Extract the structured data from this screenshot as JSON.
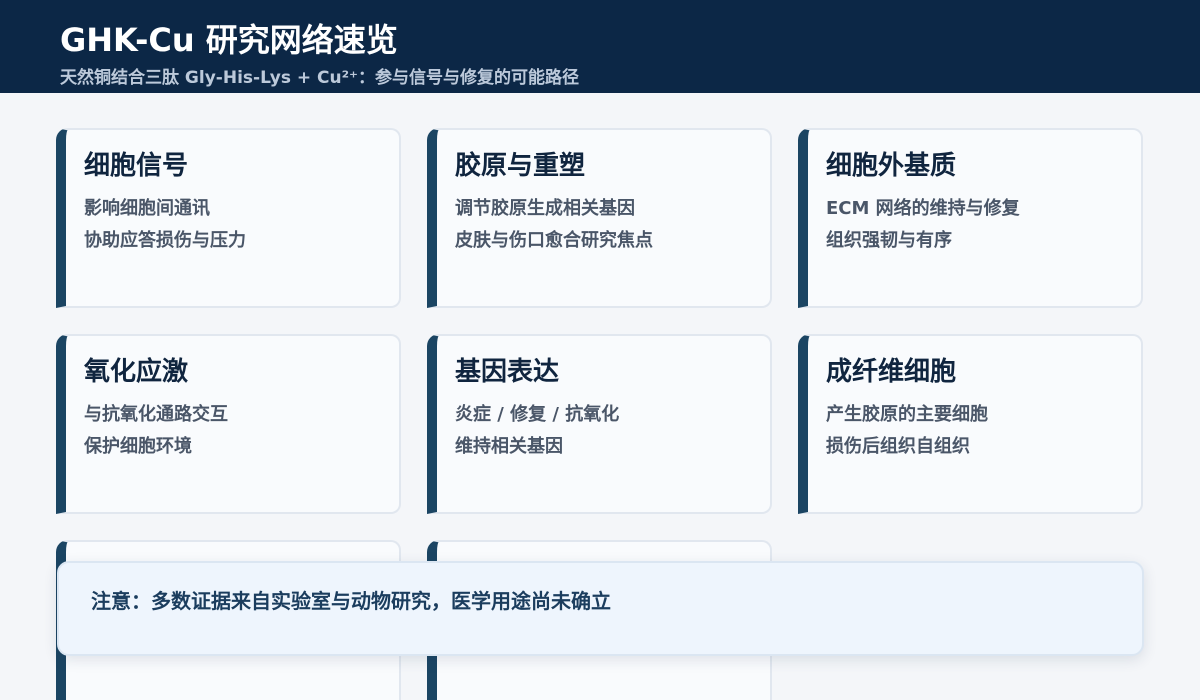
{
  "header": {
    "title": "GHK-Cu 研究网络速览",
    "subtitle": "天然铜结合三肽 Gly-His-Lys + Cu²⁺：参与信号与修复的可能路径"
  },
  "cards": [
    {
      "title": "细胞信号",
      "line1": "影响细胞间通讯",
      "line2": "协助应答损伤与压力"
    },
    {
      "title": "胶原与重塑",
      "line1": "调节胶原生成相关基因",
      "line2": "皮肤与伤口愈合研究焦点"
    },
    {
      "title": "细胞外基质",
      "line1": "ECM 网络的维持与修复",
      "line2": "组织强韧与有序"
    },
    {
      "title": "氧化应激",
      "line1": "与抗氧化通路交互",
      "line2": "保护细胞环境"
    },
    {
      "title": "基因表达",
      "line1": "炎症 / 修复 / 抗氧化",
      "line2": "维持相关基因"
    },
    {
      "title": "成纤维细胞",
      "line1": "产生胶原的主要细胞",
      "line2": "损伤后组织自组织"
    }
  ],
  "notice": {
    "text": "注意：多数证据来自实验室与动物研究，医学用途尚未确立"
  }
}
